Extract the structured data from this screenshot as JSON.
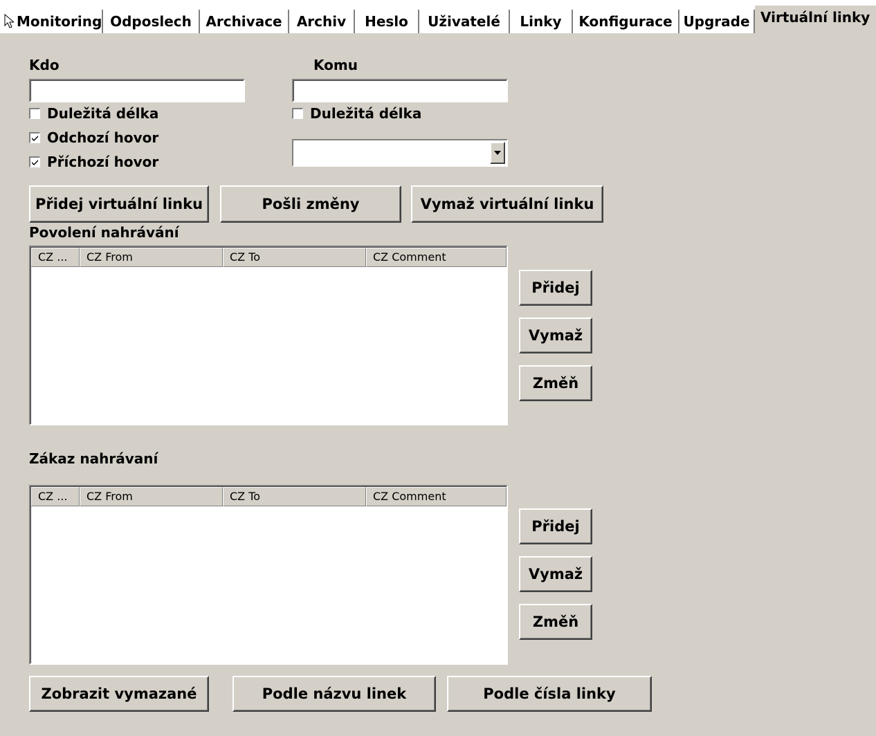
{
  "tabs": [
    "Monitoring",
    "Odposlech",
    "Archivace",
    "Archiv",
    "Heslo",
    "Uživatelé",
    "Linky",
    "Konfigurace",
    "Upgrade",
    "Virtuální linky"
  ],
  "form": {
    "kdo_label": "Kdo",
    "komu_label": "Komu",
    "kdo_value": "",
    "komu_value": "",
    "kdo_important_length": "Duležitá délka",
    "komu_important_length": "Duležitá délka",
    "outgoing_call": "Odchozí hovor",
    "incoming_call": "Příchozí hovor",
    "kdo_important_checked": false,
    "komu_important_checked": false,
    "outgoing_checked": true,
    "incoming_checked": true,
    "select_value": ""
  },
  "actions": {
    "add_virtual_line": "Přidej virtuální linku",
    "send_changes": "Pošli změny",
    "delete_virtual_line": "Vymaž virtuální linku"
  },
  "allow_section": {
    "title": "Povolení nahrávání",
    "columns": [
      "CZ ...",
      "CZ From",
      "CZ To",
      "CZ Comment"
    ],
    "rows": [],
    "add": "Přidej",
    "delete": "Vymaž",
    "change": "Změň"
  },
  "deny_section": {
    "title": "Zákaz nahrávaní",
    "columns": [
      "CZ ...",
      "CZ From",
      "CZ To",
      "CZ Comment"
    ],
    "rows": [],
    "add": "Přidej",
    "delete": "Vymaž",
    "change": "Změň"
  },
  "bottom": {
    "show_deleted": "Zobrazit vymazané",
    "by_line_name": "Podle názvu linek",
    "by_line_number": "Podle čísla linky"
  }
}
